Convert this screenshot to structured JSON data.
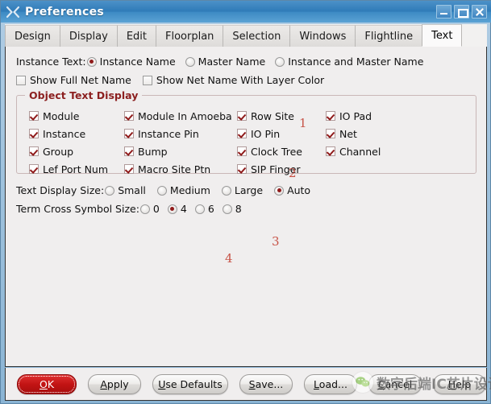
{
  "window": {
    "title": "Preferences",
    "icon": "x11-logo-icon",
    "controls": {
      "minimize": "Minimize",
      "maximize": "Maximize",
      "close": "Close"
    }
  },
  "tabs": [
    {
      "label": "Design",
      "active": false
    },
    {
      "label": "Display",
      "active": false
    },
    {
      "label": "Edit",
      "active": false
    },
    {
      "label": "Floorplan",
      "active": false
    },
    {
      "label": "Selection",
      "active": false
    },
    {
      "label": "Windows",
      "active": false
    },
    {
      "label": "Flightline",
      "active": false
    },
    {
      "label": "Text",
      "active": true
    }
  ],
  "instance_text": {
    "label": "Instance Text:",
    "options": [
      {
        "label": "Instance Name",
        "selected": true
      },
      {
        "label": "Master Name",
        "selected": false
      },
      {
        "label": "Instance and Master Name",
        "selected": false
      }
    ]
  },
  "net_name_options": [
    {
      "label": "Show Full Net Name",
      "checked": false
    },
    {
      "label": "Show Net Name With Layer Color",
      "checked": false
    }
  ],
  "object_text_display": {
    "title": "Object Text Display",
    "items": [
      {
        "label": "Module",
        "checked": true
      },
      {
        "label": "Module In Amoeba",
        "checked": true
      },
      {
        "label": "Row Site",
        "checked": true
      },
      {
        "label": "IO Pad",
        "checked": true
      },
      {
        "label": "Instance",
        "checked": true
      },
      {
        "label": "Instance Pin",
        "checked": true
      },
      {
        "label": "IO Pin",
        "checked": true
      },
      {
        "label": "Net",
        "checked": true
      },
      {
        "label": "Group",
        "checked": true
      },
      {
        "label": "Bump",
        "checked": true
      },
      {
        "label": "Clock Tree",
        "checked": true
      },
      {
        "label": "Channel",
        "checked": true
      },
      {
        "label": "Lef Port Num",
        "checked": true
      },
      {
        "label": "Macro Site Ptn",
        "checked": true
      },
      {
        "label": "SIP Finger",
        "checked": true
      }
    ]
  },
  "text_display_size": {
    "label": "Text Display Size:",
    "options": [
      {
        "label": "Small",
        "selected": false
      },
      {
        "label": "Medium",
        "selected": false
      },
      {
        "label": "Large",
        "selected": false
      },
      {
        "label": "Auto",
        "selected": true
      }
    ]
  },
  "term_cross_symbol_size": {
    "label": "Term Cross Symbol Size:",
    "options": [
      {
        "label": "0",
        "selected": false
      },
      {
        "label": "4",
        "selected": true
      },
      {
        "label": "6",
        "selected": false
      },
      {
        "label": "8",
        "selected": false
      }
    ]
  },
  "annotations": [
    {
      "text": "1"
    },
    {
      "text": "2"
    },
    {
      "text": "3"
    },
    {
      "text": "4"
    }
  ],
  "buttons": [
    {
      "label": "OK",
      "mnemonic": "O",
      "primary": true
    },
    {
      "label": "Apply",
      "mnemonic": "A",
      "primary": false
    },
    {
      "label": "Use Defaults",
      "mnemonic": "U",
      "primary": false
    },
    {
      "label": "Save...",
      "mnemonic": "S",
      "primary": false
    },
    {
      "label": "Load...",
      "mnemonic": "L",
      "primary": false
    },
    {
      "label": "Cancel",
      "mnemonic": "C",
      "primary": false
    },
    {
      "label": "Help",
      "mnemonic": "H",
      "primary": false
    }
  ],
  "watermark": {
    "text": "数字后端IC芯片设计",
    "logo": "wechat-logo-icon"
  },
  "colors": {
    "titlebar": "#2f7bb8",
    "accent_red": "#8f1a1a",
    "group_title": "#8c2020",
    "annotation": "#c0392b",
    "content_bg": "#f0eeee",
    "ok_button": "#c21414"
  }
}
